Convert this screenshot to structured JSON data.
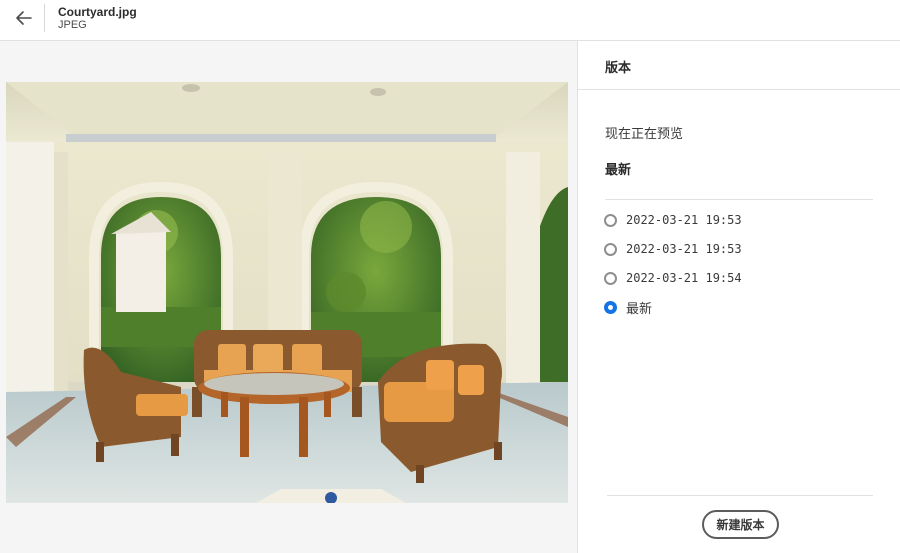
{
  "header": {
    "file_name": "Courtyard.jpg",
    "file_type": "JPEG"
  },
  "panel": {
    "title": "版本",
    "previewing_label": "现在正在预览",
    "current_version": "最新",
    "versions": [
      {
        "label": "2022-03-21 19:53",
        "selected": false
      },
      {
        "label": "2022-03-21 19:53",
        "selected": false
      },
      {
        "label": "2022-03-21 19:54",
        "selected": false
      },
      {
        "label": "最新",
        "selected": true
      }
    ],
    "new_version_button": "新建版本"
  },
  "colors": {
    "accent": "#1473e6",
    "border": "#e1e1e1",
    "preview_bg": "#f5f5f5"
  },
  "icons": {
    "back": "arrow-left-icon"
  }
}
